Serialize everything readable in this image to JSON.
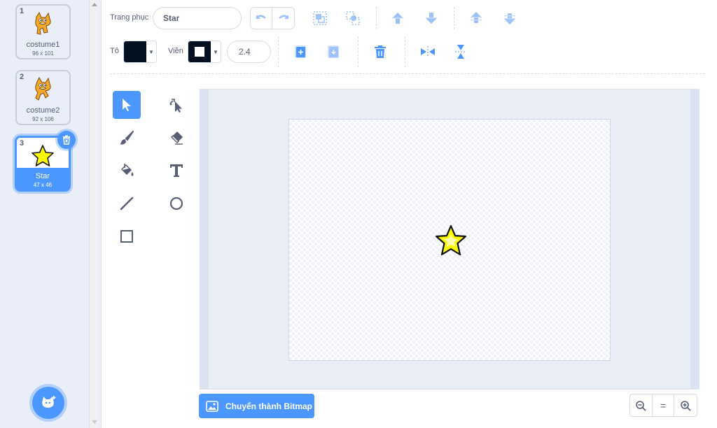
{
  "costumes": [
    {
      "num": "1",
      "name": "costume1",
      "size": "96 x 101",
      "icon": "cat-costume-icon"
    },
    {
      "num": "2",
      "name": "costume2",
      "size": "92 x 106",
      "icon": "cat-costume-icon"
    },
    {
      "num": "3",
      "name": "Star",
      "size": "47 x 46",
      "icon": "star-icon",
      "selected": true
    }
  ],
  "toolbar": {
    "costume_label": "Trang phục",
    "costume_name": "Star",
    "fill_label": "Tô",
    "outline_label": "Viền",
    "outline_width": "2.4",
    "fill_color": "#031020",
    "outline_color": "#031020"
  },
  "bottom": {
    "convert_label": "Chuyển thành Bitmap",
    "zoom_reset": "="
  },
  "colors": {
    "accent": "#4c97ff",
    "star_fill": "#ffff00",
    "text": "#575e75"
  }
}
